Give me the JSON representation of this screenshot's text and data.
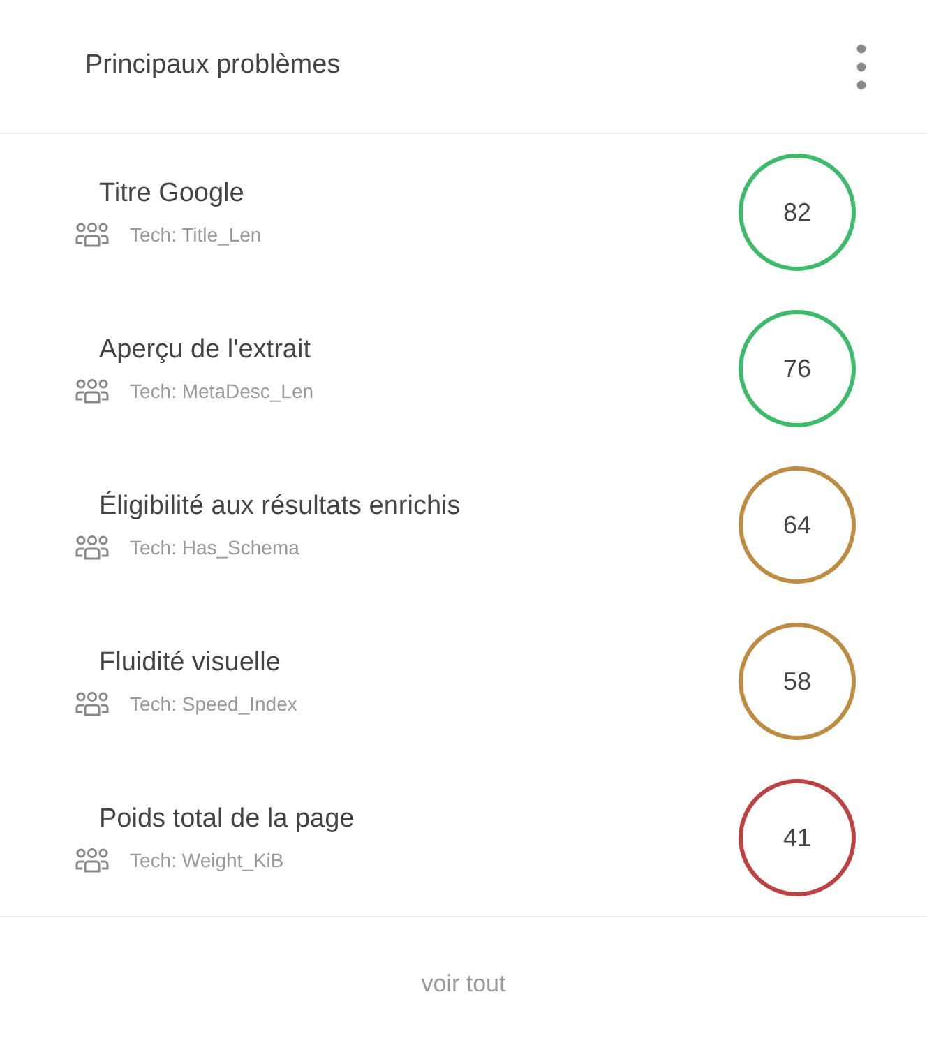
{
  "header": {
    "title": "Principaux problèmes"
  },
  "issues": [
    {
      "title": "Titre Google",
      "tech": "Tech: Title_Len",
      "score": "82",
      "color": "#3dbb6b"
    },
    {
      "title": "Aperçu de l'extrait",
      "tech": "Tech: MetaDesc_Len",
      "score": "76",
      "color": "#3dbb6b"
    },
    {
      "title": "Éligibilité aux résultats enrichis",
      "tech": "Tech: Has_Schema",
      "score": "64",
      "color": "#bd8c42"
    },
    {
      "title": "Fluidité visuelle",
      "tech": "Tech: Speed_Index",
      "score": "58",
      "color": "#bd8c42"
    },
    {
      "title": "Poids total de la page",
      "tech": "Tech: Weight_KiB",
      "score": "41",
      "color": "#bd4242"
    }
  ],
  "footer": {
    "link": "voir tout"
  }
}
